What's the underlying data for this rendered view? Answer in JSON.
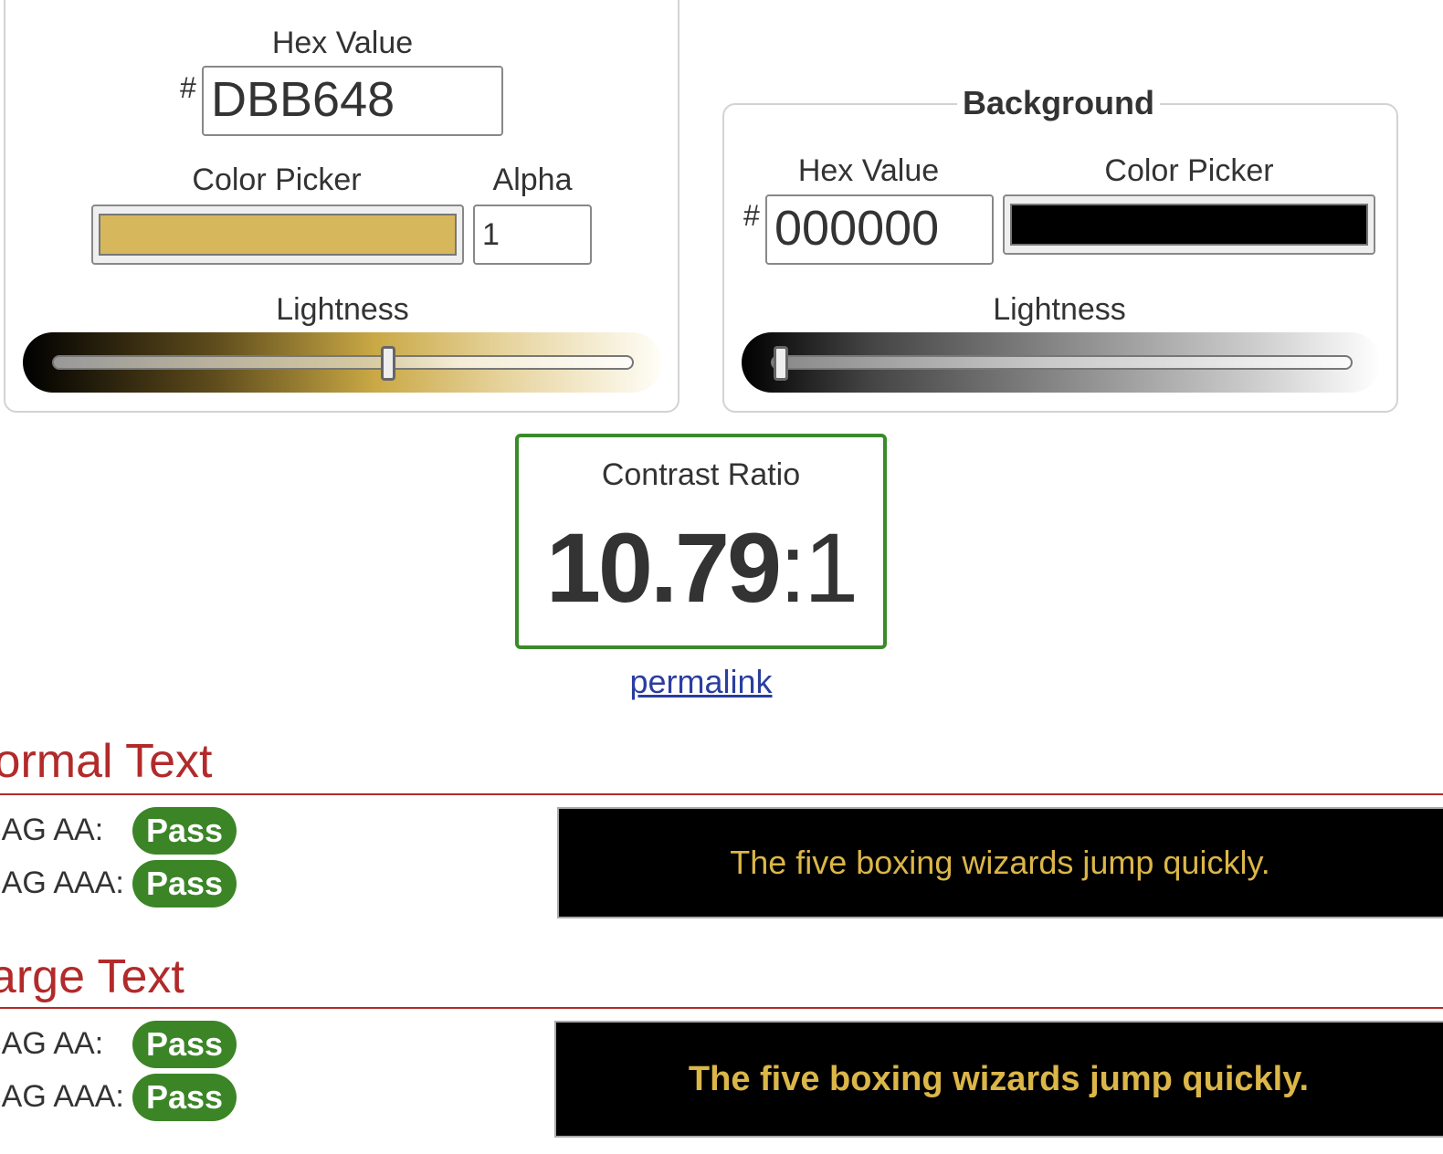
{
  "foreground": {
    "hex_label": "Hex Value",
    "hash": "#",
    "hex_value": "DBB648",
    "picker_label": "Color Picker",
    "alpha_label": "Alpha",
    "alpha_value": "1",
    "lightness_label": "Lightness",
    "lightness_percent": 58,
    "color": "#DBB648"
  },
  "background": {
    "legend": "Background",
    "hex_label": "Hex Value",
    "hash": "#",
    "hex_value": "000000",
    "picker_label": "Color Picker",
    "lightness_label": "Lightness",
    "lightness_percent": 0,
    "color": "#000000"
  },
  "contrast": {
    "label": "Contrast Ratio",
    "ratio": "10.79",
    "suffix": ":1",
    "permalink": "permalink"
  },
  "normal_text": {
    "heading": "Normal Text",
    "aa_label": "WCAG AA:",
    "aa_result": "Pass",
    "aaa_label": "WCAG AAA:",
    "aaa_result": "Pass",
    "sample": "The five boxing wizards jump quickly."
  },
  "large_text": {
    "heading": "Large Text",
    "aa_label": "WCAG AA:",
    "aa_result": "Pass",
    "aaa_label": "WCAG AAA:",
    "aaa_result": "Pass",
    "sample": "The five boxing wizards jump quickly."
  },
  "colors": {
    "pass": "#3b8527",
    "heading": "#b22a2a",
    "border_ok": "#3a8a2a",
    "link": "#2a3ea0"
  }
}
